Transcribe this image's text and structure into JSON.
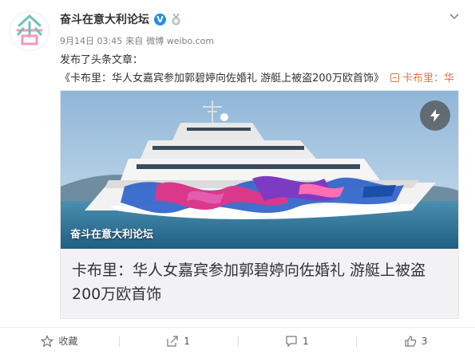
{
  "post": {
    "username": "奋斗在意大利论坛",
    "verified_mark": "V",
    "date": "9月14日 03:45",
    "via_label": "来自",
    "source": "微博 weibo.com",
    "text_prefix": "发布了头条文章：",
    "article_quote": "《卡布里：华人女嘉宾参加郭碧婷向佐婚礼 游艇上被盗200万欧首饰》",
    "inline_link_text": "卡布里：华人女嘉宾参加郭碧婷向佐婚礼 游艇...",
    "card": {
      "image_caption": "奋斗在意大利论坛",
      "title": "卡布里：华人女嘉宾参加郭碧婷向佐婚礼 游艇上被盗200万欧首饰"
    }
  },
  "actions": [
    {
      "icon": "star-icon",
      "label": "收藏"
    },
    {
      "icon": "share-icon",
      "label": "1"
    },
    {
      "icon": "comment-icon",
      "label": "1"
    },
    {
      "icon": "thumbs-up-icon",
      "label": "3"
    }
  ],
  "colors": {
    "link": "#eb7350",
    "verified": "#1e90e6",
    "text": "#333333",
    "meta": "#808080"
  }
}
